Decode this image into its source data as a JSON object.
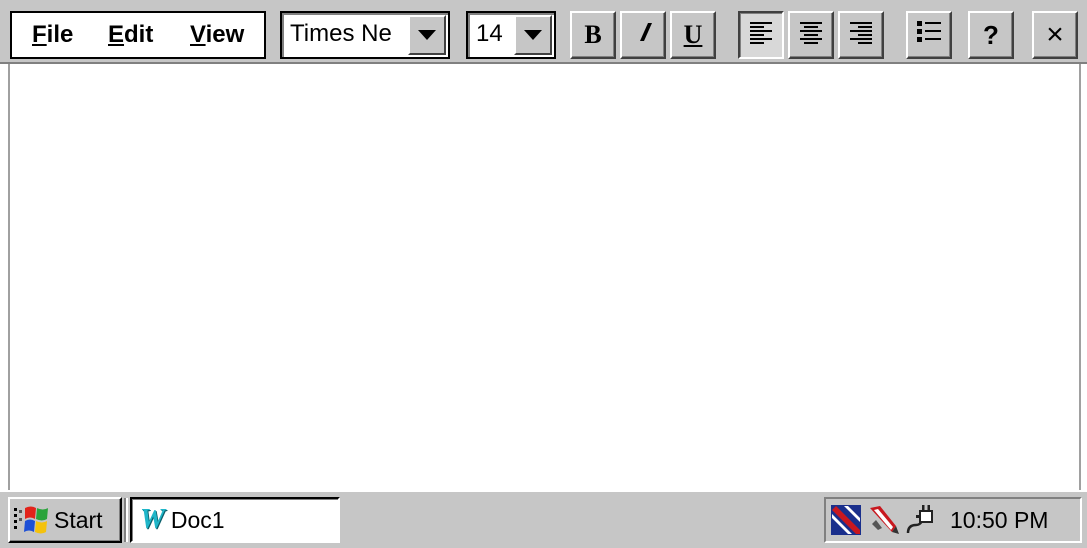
{
  "menu": {
    "file_label": "File",
    "file_accel": "F",
    "file_rest": "ile",
    "edit_accel": "E",
    "edit_rest": "dit",
    "view_accel": "V",
    "view_rest": "iew"
  },
  "toolbar": {
    "font_value": "Times Ne",
    "size_value": "14",
    "bold_glyph": "B",
    "underline_glyph": "U",
    "help_glyph": "?",
    "close_glyph": "×",
    "align_left_pressed": true,
    "icons": [
      "chevron-down-icon",
      "bold-icon",
      "italic-icon",
      "underline-icon",
      "align-left-icon",
      "align-center-icon",
      "align-right-icon",
      "bullet-list-icon",
      "help-icon",
      "close-icon"
    ]
  },
  "document": {
    "content": ""
  },
  "taskbar": {
    "start_label": "Start",
    "task_label": "Doc1",
    "task_icon_glyph": "W",
    "clock": "10:50 PM",
    "tray_icons": [
      "network-icon",
      "pen-icon",
      "power-plug-icon"
    ]
  },
  "colors": {
    "chrome": "#c6c6c6",
    "document_bg": "#ffffff",
    "task_icon": "#1fb6c9"
  }
}
